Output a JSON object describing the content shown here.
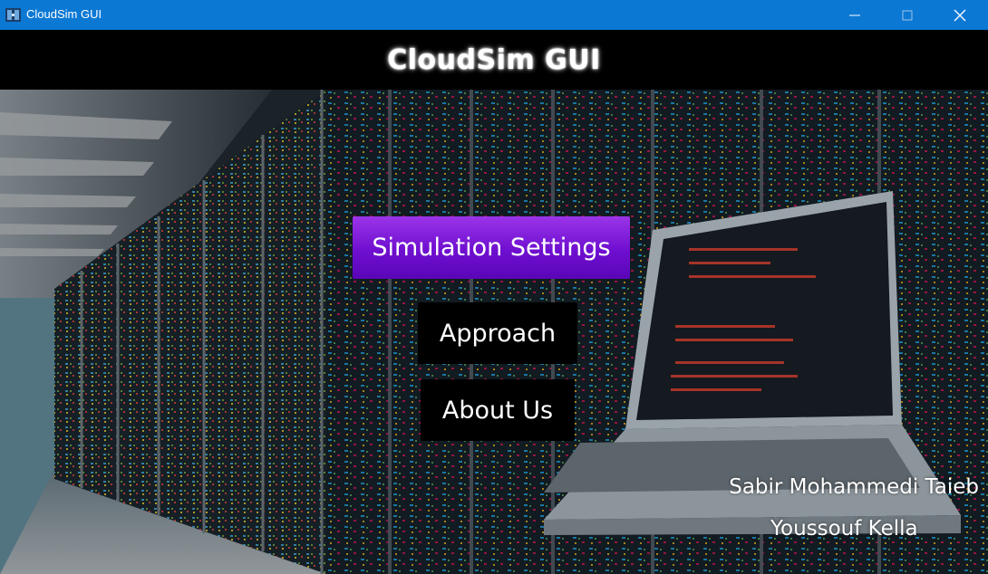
{
  "window": {
    "title": "CloudSim GUI",
    "controls": [
      "minimize",
      "maximize",
      "close"
    ],
    "accent_color": "#0b78d4"
  },
  "header": {
    "title": "CloudSim GUI"
  },
  "menu": {
    "simulation_settings_label": "Simulation Settings",
    "approach_label": "Approach",
    "about_us_label": "About Us"
  },
  "credits": {
    "author_1": "Sabir Mohammedi Taieb",
    "author_2": "Youssouf Kella"
  },
  "colors": {
    "primary_button": "#7a18d6",
    "dark_button": "#000000",
    "header_bg": "#000000"
  }
}
